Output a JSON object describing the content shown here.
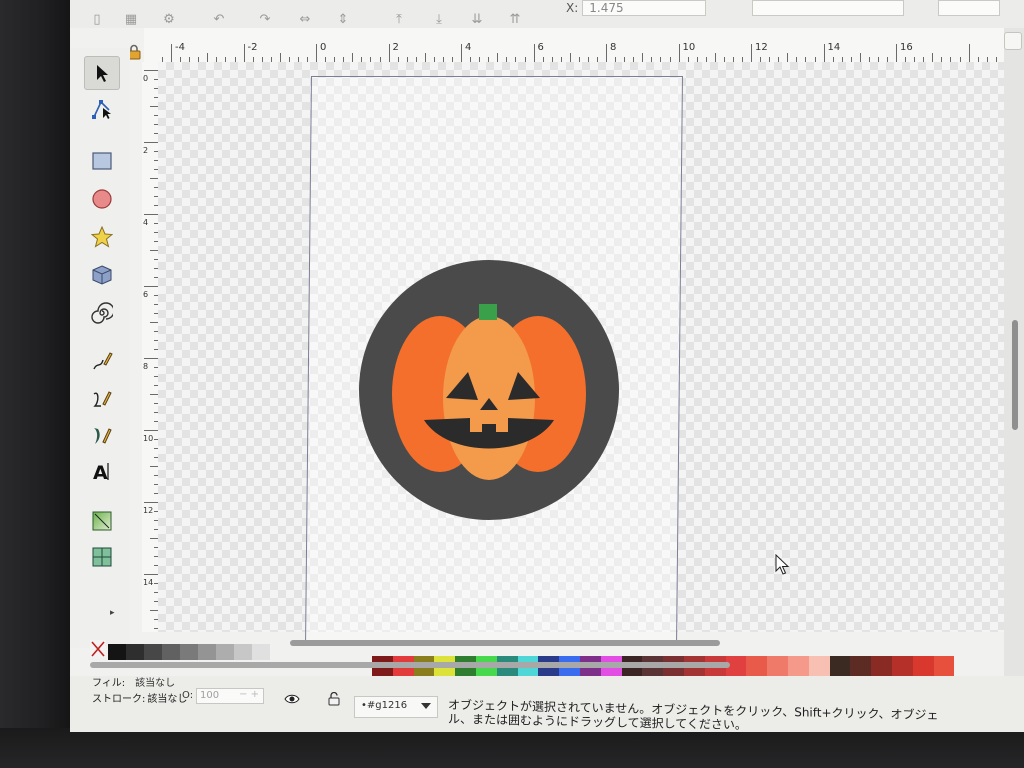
{
  "app": {
    "coord_x_label": "X:",
    "coord_x_value": "1.475"
  },
  "ruler": {
    "h_labels": [
      "-4",
      "-2",
      "0",
      "2",
      "4",
      "6",
      "8",
      "10",
      "12",
      "14",
      "16"
    ],
    "v_labels": [
      "0",
      "2",
      "4",
      "6",
      "8",
      "10",
      "12",
      "14"
    ]
  },
  "toolbox": {
    "tools": [
      {
        "name": "selector-tool",
        "icon": "arrow-pointer-icon"
      },
      {
        "name": "node-tool",
        "icon": "node-edit-icon"
      },
      {
        "name": "rectangle-tool",
        "icon": "rectangle-icon"
      },
      {
        "name": "ellipse-tool",
        "icon": "circle-icon"
      },
      {
        "name": "star-tool",
        "icon": "star-icon"
      },
      {
        "name": "3d-box-tool",
        "icon": "cube-icon"
      },
      {
        "name": "spiral-tool",
        "icon": "spiral-icon"
      },
      {
        "name": "pencil-tool",
        "icon": "pencil-icon"
      },
      {
        "name": "pen-tool",
        "icon": "bezier-pen-icon"
      },
      {
        "name": "calligraphy-tool",
        "icon": "calligraphy-icon"
      },
      {
        "name": "text-tool",
        "icon": "text-icon"
      },
      {
        "name": "gradient-tool",
        "icon": "gradient-icon"
      },
      {
        "name": "mesh-tool",
        "icon": "mesh-icon"
      }
    ],
    "more": "▸"
  },
  "artwork": {
    "background_circle_color": "#4a4a4a",
    "pumpkin_outer_color": "#f36f2b",
    "pumpkin_center_color": "#f39a4b",
    "stem_color": "#3aa04a",
    "face_color": "#2b2b2b"
  },
  "palette": {
    "grays": [
      "#141414",
      "#2e2e2e",
      "#474747",
      "#616161",
      "#7a7a7a",
      "#949494",
      "#adadad",
      "#c7c7c7",
      "#e0e0e0"
    ],
    "colors": [
      "#7e1a1a",
      "#e33b3b",
      "#8a7d1c",
      "#dce23a",
      "#2f7d2f",
      "#48d84d",
      "#2a8a7b",
      "#4fd7d7",
      "#2a3b8a",
      "#3a6cf0",
      "#7e2f8a",
      "#e24ee4",
      "#3a2424",
      "#5a3434",
      "#7a3030",
      "#a33434",
      "#c83a3a",
      "#e04040",
      "#e85a4a",
      "#f07a6a",
      "#f59a8a",
      "#f7c0b2",
      "#3b2a22",
      "#5c2c24",
      "#8a2a24",
      "#b53028",
      "#d8382e",
      "#e8503e"
    ]
  },
  "status": {
    "fill_label": "フィル:",
    "fill_value": "該当なし",
    "stroke_label": "ストローク:",
    "stroke_value": "該当なし",
    "opacity_label": "O:",
    "opacity_value": "100",
    "layer_value": "•#g1216",
    "message_line1": "オブジェクトが選択されていません。オブジェクトをクリック、Shift+クリック、オブジェ",
    "message_line2": "ル、または囲むようにドラッグして選択してください。"
  }
}
